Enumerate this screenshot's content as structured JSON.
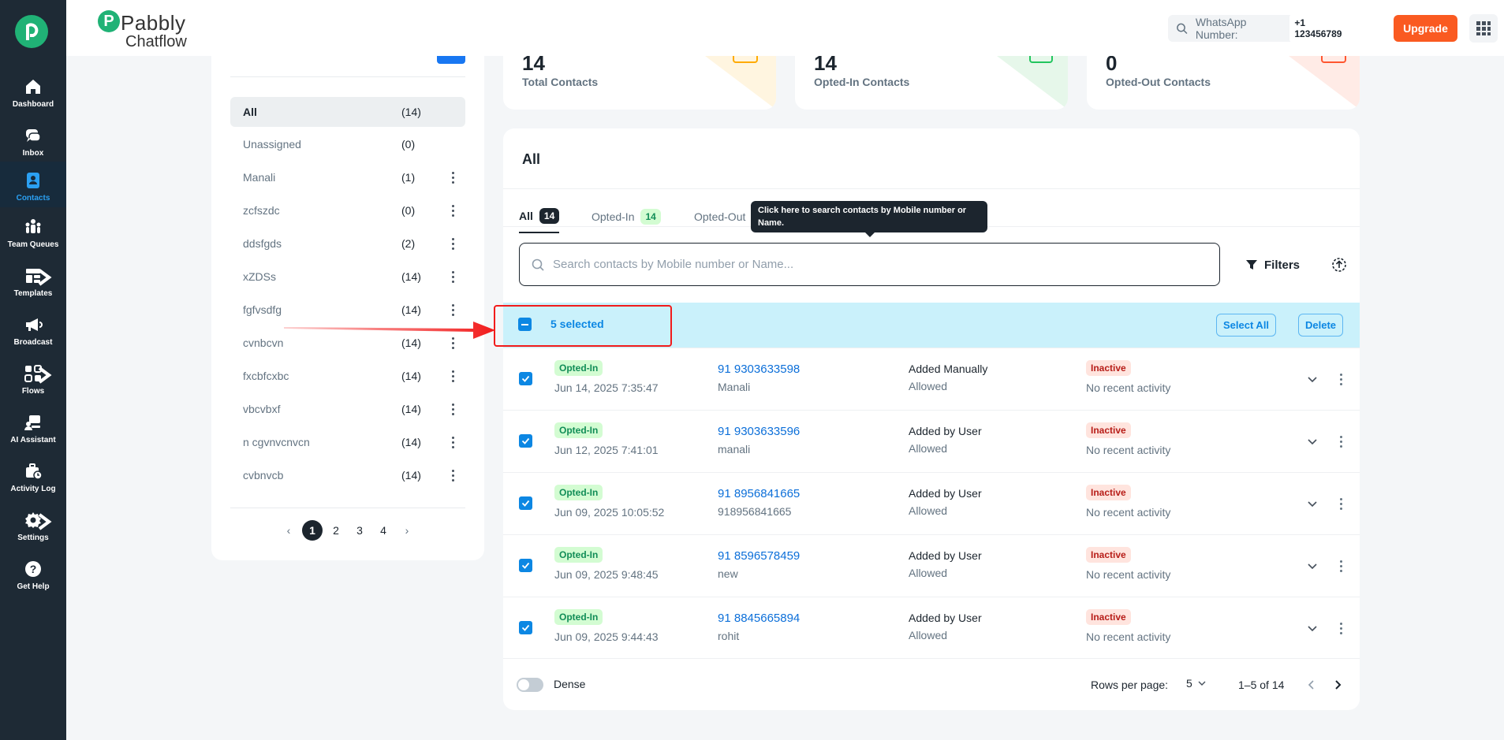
{
  "brand": {
    "name": "Pabbly",
    "sub": "Chatflow"
  },
  "nav": [
    {
      "label": "Dashboard"
    },
    {
      "label": "Inbox"
    },
    {
      "label": "Contacts"
    },
    {
      "label": "Team Queues"
    },
    {
      "label": "Templates"
    },
    {
      "label": "Broadcast"
    },
    {
      "label": "Flows"
    },
    {
      "label": "AI Assistant"
    },
    {
      "label": "Activity Log"
    },
    {
      "label": "Settings"
    },
    {
      "label": "Get Help"
    }
  ],
  "header": {
    "wa_label": "WhatsApp Number:",
    "wa_number": "+1 123456789",
    "upgrade": "Upgrade"
  },
  "lists": [
    {
      "name": "All",
      "count": "(14)"
    },
    {
      "name": "Unassigned",
      "count": "(0)"
    },
    {
      "name": "Manali",
      "count": "(1)"
    },
    {
      "name": "zcfszdc",
      "count": "(0)"
    },
    {
      "name": "ddsfgds",
      "count": "(2)"
    },
    {
      "name": "xZDSs",
      "count": "(14)"
    },
    {
      "name": "fgfvsdfg",
      "count": "(14)"
    },
    {
      "name": "cvnbcvn",
      "count": "(14)"
    },
    {
      "name": "fxcbfcxbc",
      "count": "(14)"
    },
    {
      "name": "vbcvbxf",
      "count": "(14)"
    },
    {
      "name": "n cgvnvcnvcn",
      "count": "(14)"
    },
    {
      "name": "cvbnvcb",
      "count": "(14)"
    }
  ],
  "lists_pager": [
    "1",
    "2",
    "3",
    "4"
  ],
  "stats": [
    {
      "num": "14",
      "label": "Total Contacts",
      "color": "#ffab00"
    },
    {
      "num": "14",
      "label": "Opted-In Contacts",
      "color": "#22c55e"
    },
    {
      "num": "0",
      "label": "Opted-Out Contacts",
      "color": "#ff5630"
    }
  ],
  "main": {
    "title": "All",
    "tabs": [
      {
        "label": "All",
        "count": "14"
      },
      {
        "label": "Opted-In",
        "count": "14"
      },
      {
        "label": "Opted-Out",
        "count": ""
      }
    ],
    "tooltip": "Click here to search contacts by Mobile number or Name.",
    "search_placeholder": "Search contacts by Mobile number or Name...",
    "filters": "Filters",
    "selected_text": "5 selected",
    "select_all": "Select All",
    "delete": "Delete"
  },
  "rows": [
    {
      "status": "Opted-In",
      "date": "Jun 14, 2025 7:35:47",
      "phone": "91 9303633598",
      "name": "Manali",
      "source": "Added Manually",
      "allowed": "Allowed",
      "state": "Inactive",
      "activity": "No recent activity"
    },
    {
      "status": "Opted-In",
      "date": "Jun 12, 2025 7:41:01",
      "phone": "91 9303633596",
      "name": "manali",
      "source": "Added by User",
      "allowed": "Allowed",
      "state": "Inactive",
      "activity": "No recent activity"
    },
    {
      "status": "Opted-In",
      "date": "Jun 09, 2025 10:05:52",
      "phone": "91 8956841665",
      "name": "918956841665",
      "source": "Added by User",
      "allowed": "Allowed",
      "state": "Inactive",
      "activity": "No recent activity"
    },
    {
      "status": "Opted-In",
      "date": "Jun 09, 2025 9:48:45",
      "phone": "91 8596578459",
      "name": "new",
      "source": "Added by User",
      "allowed": "Allowed",
      "state": "Inactive",
      "activity": "No recent activity"
    },
    {
      "status": "Opted-In",
      "date": "Jun 09, 2025 9:44:43",
      "phone": "91 8845665894",
      "name": "rohit",
      "source": "Added by User",
      "allowed": "Allowed",
      "state": "Inactive",
      "activity": "No recent activity"
    }
  ],
  "footer": {
    "dense": "Dense",
    "rows_per_page_label": "Rows per page:",
    "rows_per_page": "5",
    "range": "1–5 of 14"
  },
  "colors": {
    "nav_bg": "#1e2a35",
    "accent": "#0c87e3",
    "brand_green": "#20b276",
    "upgrade": "#fa5a21",
    "annotation_red": "#f21b1b"
  }
}
